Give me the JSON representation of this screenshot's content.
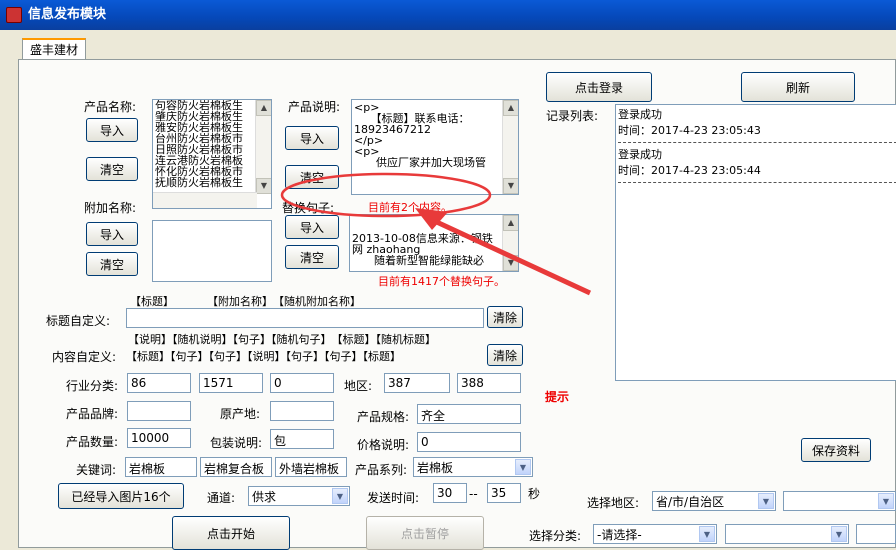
{
  "window": {
    "title": "信息发布模块"
  },
  "tab": {
    "label": "盛丰建材"
  },
  "products": {
    "label": "产品名称:",
    "items": [
      "句容防火岩棉板生",
      "肇庆防火岩棉板生",
      "雅安防火岩棉板生",
      "台州防火岩棉板市",
      "日照防火岩棉板市",
      "连云港防火岩棉板",
      "怀化防火岩棉板市",
      "抚顺防火岩棉板生"
    ],
    "import_label": "导入",
    "clear_label": "清空"
  },
  "extra": {
    "label": "附加名称:",
    "import_label": "导入",
    "clear_label": "清空"
  },
  "desc": {
    "label": "产品说明:",
    "lines": [
      "<p>",
      "　　【标题】联系电话：",
      "18923467212",
      "</p>",
      "<p>",
      "　　供应厂家并加大现场管"
    ],
    "import_label": "导入",
    "clear_label": "清空",
    "count_note": "目前有2个内容。"
  },
  "replace": {
    "label": "替换句子:",
    "lines": [
      "2013-10-08信息来源：钢铁",
      "网 zhaohang",
      "　　随着新型智能绿能缺必"
    ],
    "import_label": "导入",
    "clear_label": "清空",
    "count_note": "目前有1417个替换句子。"
  },
  "title_tokens": "【标题】　　　　【附加名称】　【随机附加名称】",
  "title_custom": {
    "label": "标题自定义:",
    "value": "",
    "clear_label": "清除"
  },
  "content_tokens": "【说明】【随机说明】【句子】【随机句子】　【标题】【随机标题】",
  "content_custom": {
    "label": "内容自定义:",
    "value": "【标题】【句子】【句子】【说明】【句子】【句子】【标题】",
    "clear_label": "清除"
  },
  "industry": {
    "label": "行业分类:",
    "v1": "86",
    "v2": "1571",
    "v3": "0"
  },
  "region": {
    "label": "地区:",
    "v1": "387",
    "v2": "388"
  },
  "hint": "提示",
  "brand": {
    "label": "产品品牌:",
    "value": ""
  },
  "origin": {
    "label": "原产地:",
    "value": ""
  },
  "spec": {
    "label": "产品规格:",
    "value": "齐全"
  },
  "qty": {
    "label": "产品数量:",
    "value": "10000"
  },
  "pack": {
    "label": "包装说明:",
    "value": "包"
  },
  "price": {
    "label": "价格说明:",
    "value": "0"
  },
  "keywords": {
    "label": "关键词:",
    "k1": "岩棉板",
    "k2": "岩棉复合板",
    "k3": "外墙岩棉板"
  },
  "series": {
    "label": "产品系列:",
    "value": "岩棉板"
  },
  "images_button": "已经导入图片16个",
  "channel": {
    "label": "通道:",
    "value": "供求"
  },
  "send_time": {
    "label": "发送时间:",
    "from": "30",
    "dash": "--",
    "to": "35",
    "unit": "秒"
  },
  "start_button": "点击开始",
  "pause_button": "点击暂停",
  "login_button": "点击登录",
  "refresh_button": "刷新",
  "log": {
    "label": "记录列表:",
    "entries": [
      {
        "status": "登录成功",
        "time": "时间：2017-4-23 23:05:43"
      },
      {
        "status": "登录成功",
        "time": "时间：2017-4-23 23:05:44"
      }
    ]
  },
  "save_button": "保存资料",
  "select_region": {
    "label": "选择地区:",
    "value": "省/市/自治区"
  },
  "select_category": {
    "label": "选择分类:",
    "value": "-请选择-"
  },
  "colors": {
    "annotation": "#e83a3a",
    "titlebar": "#0a5ad6"
  }
}
